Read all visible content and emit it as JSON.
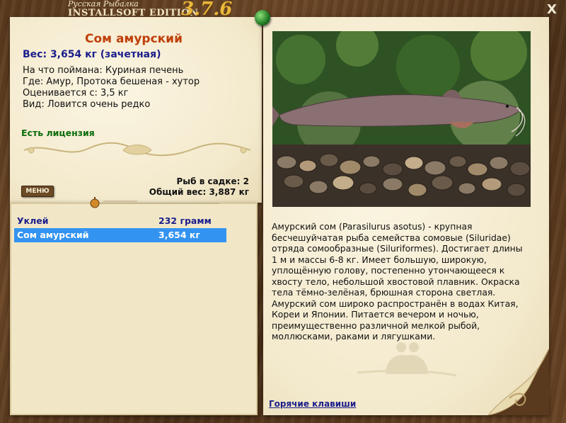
{
  "app": {
    "title_line1": "Русская Рыбалка",
    "title_line2": "INSTALLSOFT EDITION",
    "version": "3.7.6",
    "close_label": "X"
  },
  "fish": {
    "name": "Сом амурский",
    "weight_line": "Вес: 3,654 кг (зачетная)",
    "bait": "На что поймана: Куриная печень",
    "place": "Где: Амур, Протока бешеная - хутор",
    "price": "Оценивается с: 3,5 кг",
    "species_rarity": "Вид: Ловится очень редко",
    "license": "Есть лицензия"
  },
  "keepnet": {
    "count": "Рыб в садке: 2",
    "total": "Общий вес: 3,887 кг"
  },
  "menu_label": "МЕНЮ",
  "catch_list": [
    {
      "name": "Уклей",
      "weight": "232 грамм"
    },
    {
      "name": "Сом амурский",
      "weight": "3,654 кг"
    }
  ],
  "description": "Амурский сом (Parasilurus asotus) - крупная бесчешуйчатая рыба семейства сомовые (Siluridae) отряда сомообразные (Siluriformes). Достигает длины 1 м и массы 6-8 кг. Имеет большую, широкую, уплощённую голову, постепенно утончающееся к хвосту тело, небольшой хвостовой плавник. Окраска тела тёмно-зелёная, брюшная сторона светлая. Амурский сом широко распространён в водах Китая, Кореи и Японии. Питается вечером и ночью, преимущественно различной мелкой рыбой, моллюсками, раками и лягушками.",
  "hotkeys_label": "Горячие клавиши",
  "colors": {
    "fish_name": "#c0400a",
    "weight": "#1b1e8c",
    "license": "#0c6c0c",
    "selection": "#3393f0",
    "version": "#e8b83a"
  }
}
